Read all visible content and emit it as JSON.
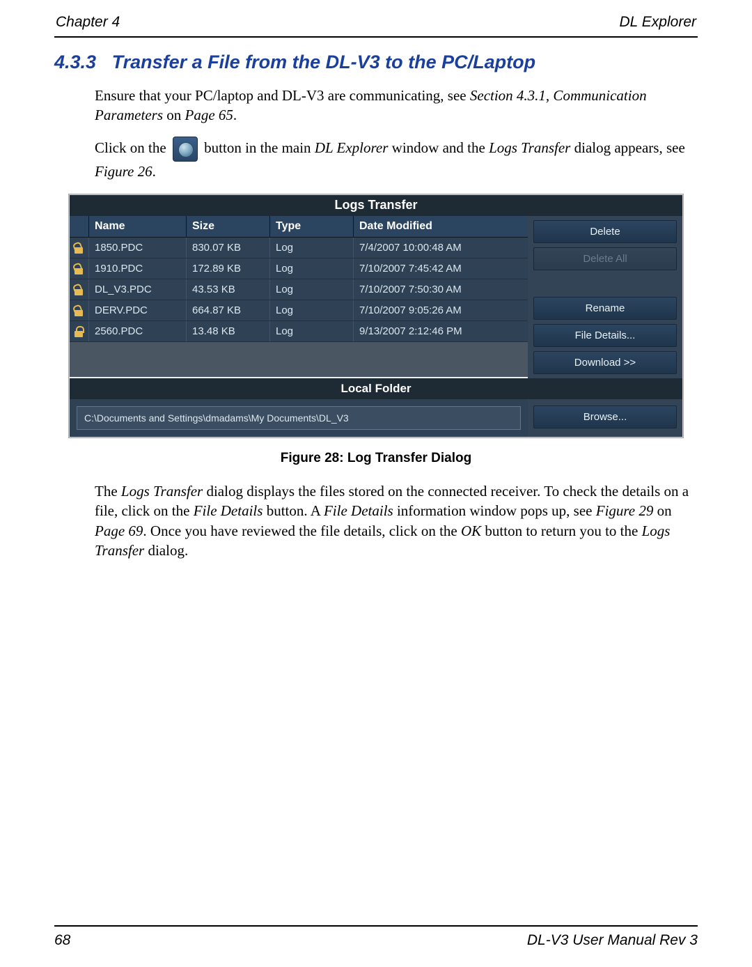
{
  "header": {
    "left": "Chapter 4",
    "right": "DL Explorer"
  },
  "heading": {
    "num": "4.3.3",
    "title": "Transfer a File from the DL-V3 to the PC/Laptop"
  },
  "para1": {
    "pre": "Ensure that your PC/laptop and DL-V3 are communicating, see ",
    "ref": "Section 4.3.1, Communication Parameters",
    "post_on": " on ",
    "page": "Page 65",
    "end": "."
  },
  "para2": {
    "a": "Click on the ",
    "b": " button in the main ",
    "c": "DL Explorer",
    "d": " window and the ",
    "e": "Logs Transfer",
    "f": " dialog appears, see ",
    "g": "Figure 26",
    "h": "."
  },
  "dialog": {
    "title": "Logs Transfer",
    "columns": {
      "name": "Name",
      "size": "Size",
      "type": "Type",
      "date": "Date Modified"
    },
    "rows": [
      {
        "locked": false,
        "name": "1850.PDC",
        "size": "830.07 KB",
        "type": "Log",
        "date": "7/4/2007 10:00:48 AM"
      },
      {
        "locked": false,
        "name": "1910.PDC",
        "size": "172.89 KB",
        "type": "Log",
        "date": "7/10/2007 7:45:42 AM"
      },
      {
        "locked": false,
        "name": "DL_V3.PDC",
        "size": "43.53 KB",
        "type": "Log",
        "date": "7/10/2007 7:50:30 AM"
      },
      {
        "locked": false,
        "name": "DERV.PDC",
        "size": "664.87 KB",
        "type": "Log",
        "date": "7/10/2007 9:05:26 AM"
      },
      {
        "locked": true,
        "name": "2560.PDC",
        "size": "13.48 KB",
        "type": "Log",
        "date": "9/13/2007 2:12:46 PM"
      }
    ],
    "buttons": {
      "delete": "Delete",
      "delete_all": "Delete All",
      "rename": "Rename",
      "file_details": "File Details...",
      "download": "Download >>",
      "browse": "Browse..."
    },
    "local_title": "Local Folder",
    "local_path": "C:\\Documents and Settings\\dmadams\\My Documents\\DL_V3"
  },
  "figure_caption": "Figure 28: Log Transfer Dialog",
  "para3": {
    "a": "The ",
    "b": "Logs Transfer",
    "c": " dialog displays the files stored on the connected receiver. To check the details on a file, click on the ",
    "d": "File Details",
    "e": " button. A ",
    "f": "File Details",
    "g": " information window pops up, see ",
    "h": "Figure 29",
    "i": " on ",
    "j": "Page 69",
    "k": ". Once you have reviewed the file details, click on the ",
    "l": "OK",
    "m": " button to return you to the ",
    "n": "Logs Transfer",
    "o": " dialog."
  },
  "footer": {
    "page": "68",
    "title": "DL-V3 User Manual Rev 3"
  }
}
